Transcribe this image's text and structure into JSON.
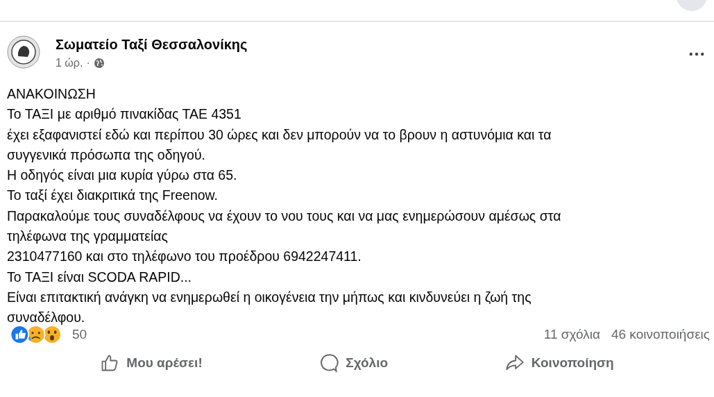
{
  "post": {
    "author": "Σωματείο Ταξί Θεσσαλονίκης",
    "time": "1 ώρ.",
    "separator": "·",
    "lines": [
      "ΑΝΑΚΟΙΝΩΣΗ",
      "Το ΤΑΞΙ με αριθμό πινακίδας ΤΑΕ 4351",
      "έχει εξαφανιστεί εδώ και περίπου 30 ώρες και δεν μπορούν να το βρουν η αστυνόμια και τα",
      "συγγενικά πρόσωπα της οδηγού.",
      "Η οδηγός είναι μια κυρία γύρω στα 65.",
      "Το ταξί έχει διακριτικά της Freenow.",
      "Παρακαλούμε τους συναδέλφους να έχουν το νου τους και να μας ενημερώσουν αμέσως στα",
      "τηλέφωνα της γραμματείας",
      "2310477160 και στο τηλέφωνο του προέδρου 6942247411.",
      "Το ΤΑΞΙ είναι SCODA RAPID...",
      "Είναι επιτακτική ανάγκη να ενημερωθεί η οικογένεια την μήπως και κινδυνεύει η ζωή της",
      "συναδέλφου."
    ],
    "reaction_count": "50",
    "comments": "11 σχόλια",
    "shares": "46 κοινοποιήσεις"
  },
  "actions": [
    {
      "kind": "like",
      "label": "Μου αρέσει!"
    },
    {
      "kind": "comment",
      "label": "Σχόλιο"
    },
    {
      "kind": "share",
      "label": "Κοινοποίηση"
    }
  ]
}
